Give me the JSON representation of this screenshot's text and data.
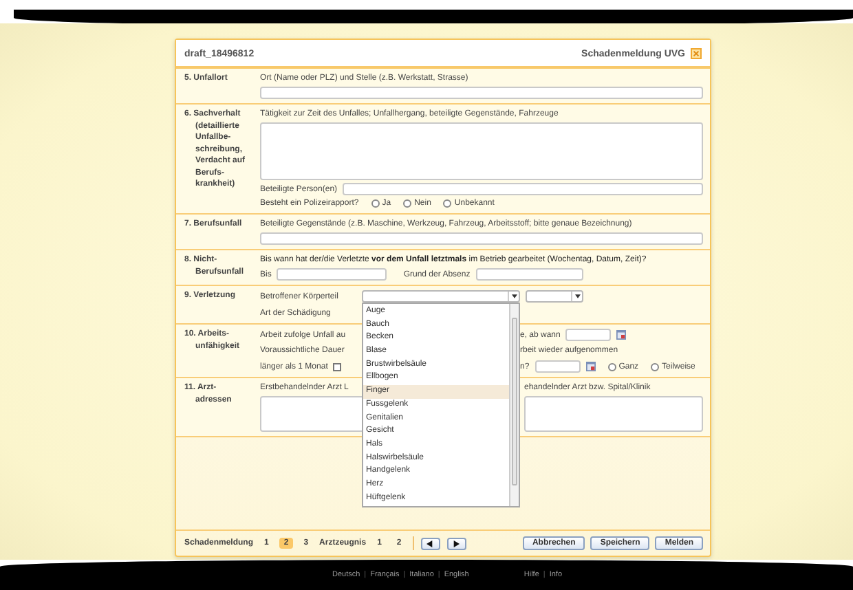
{
  "header": {
    "title": "draft_18496812",
    "form_name": "Schadenmeldung UVG"
  },
  "unfallort": {
    "label": "5. Unfallort",
    "hint": "Ort (Name oder PLZ) und Stelle (z.B. Werkstatt, Strasse)"
  },
  "sachverhalt": {
    "label": "6. Sachverhalt (detaillierte Unfallbe-schreibung, Verdacht auf Berufs-krankheit)",
    "hint": "Tätigkeit zur Zeit des Unfalles; Unfallhergang, beteiligte Gegenstände, Fahrzeuge",
    "persons_label": "Beteiligte Person(en)",
    "police_question": "Besteht ein Polizeirapport?",
    "police_options": [
      {
        "label": "Ja",
        "selected": false
      },
      {
        "label": "Nein",
        "selected": false
      },
      {
        "label": "Unbekannt",
        "selected": false
      }
    ]
  },
  "berufsunfall": {
    "label": "7. Berufsunfall",
    "hint": "Beteiligte Gegenstände (z.B. Maschine, Werkzeug, Fahrzeug, Arbeitsstoff; bitte genaue Bezeichnung)"
  },
  "nicht_berufsunfall": {
    "label": "8. Nicht-Berufsunfall",
    "question": "Bis wann hat der/die Verletzte **vor dem Unfall letztmals** im Betrieb gearbeitet (Wochentag, Datum, Zeit)?",
    "until_label": "Bis",
    "reason_label": "Grund der Absenz"
  },
  "verletzung": {
    "label": "9. Verletzung",
    "body_part_label": "Betroffener Körperteil",
    "damage_label": "Art der Schädigung",
    "dropdown_open": true,
    "options": [
      {
        "label": "Auge",
        "selected": false
      },
      {
        "label": "Bauch",
        "selected": false
      },
      {
        "label": "Becken",
        "selected": false
      },
      {
        "label": "Blase",
        "selected": false
      },
      {
        "label": "Brustwirbelsäule",
        "selected": false
      },
      {
        "label": "Ellbogen",
        "selected": false
      },
      {
        "label": "Finger",
        "selected": true
      },
      {
        "label": "Fussgelenk",
        "selected": false
      },
      {
        "label": "Genitalien",
        "selected": false
      },
      {
        "label": "Gesicht",
        "selected": false
      },
      {
        "label": "Hals",
        "selected": false
      },
      {
        "label": "Halswirbelsäule",
        "selected": false
      },
      {
        "label": "Handgelenk",
        "selected": false
      },
      {
        "label": "Herz",
        "selected": false
      },
      {
        "label": "Hüftgelenk",
        "selected": false
      }
    ]
  },
  "arbeitsunfaehigkeit": {
    "label": "10. Arbeits-unfähigkeit",
    "row1_left": "Arbeit zufolge Unfall au",
    "row1_right": "e, ab wann",
    "row2_left": "Voraussichtliche Dauer",
    "row2_right": "rbeit wieder aufgenommen",
    "row3_left": "länger als 1 Monat",
    "row3_checked": false,
    "row3_right": "n?",
    "resume_options": [
      {
        "label": "Ganz",
        "selected": false
      },
      {
        "label": "Teilweise",
        "selected": false
      }
    ]
  },
  "arztadressen": {
    "label": "11. Arzt-adressen",
    "left_hint": "Erstbehandelnder Arzt L",
    "right_hint": "ehandelnder Arzt bzw. Spital/Klinik"
  },
  "pager": [
    {
      "kind": "group",
      "label": "Schadenmeldung"
    },
    {
      "kind": "page",
      "label": "1",
      "selected": false
    },
    {
      "kind": "page",
      "label": "2",
      "selected": true
    },
    {
      "kind": "page",
      "label": "3",
      "selected": false
    },
    {
      "kind": "group",
      "label": "Arztzeugnis"
    },
    {
      "kind": "page",
      "label": "1",
      "selected": false
    },
    {
      "kind": "page",
      "label": "2",
      "selected": false
    }
  ],
  "buttons": [
    "Abbrechen",
    "Speichern",
    "Melden"
  ],
  "footer": {
    "languages": [
      {
        "kind": "link",
        "label": "Deutsch"
      },
      {
        "kind": "sep",
        "label": "|"
      },
      {
        "kind": "link",
        "label": "Français"
      },
      {
        "kind": "sep",
        "label": "|"
      },
      {
        "kind": "link",
        "label": "Italiano"
      },
      {
        "kind": "sep",
        "label": "|"
      },
      {
        "kind": "link",
        "label": "English"
      }
    ],
    "help": [
      {
        "kind": "link",
        "label": "Hilfe"
      },
      {
        "kind": "sep",
        "label": "|"
      },
      {
        "kind": "link",
        "label": "Info"
      }
    ]
  }
}
